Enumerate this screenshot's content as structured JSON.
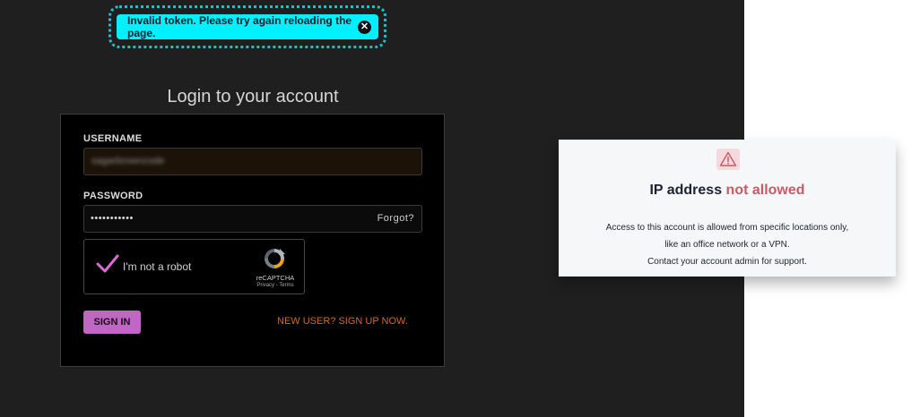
{
  "toast": {
    "message": "Invalid token. Please try again reloading the page.",
    "close_icon": "close-circle-icon",
    "close_glyph": "✕",
    "color": "#00f0ff"
  },
  "login": {
    "title": "Login to your account",
    "username_label": "USERNAME",
    "username_value": "sagarbrowncode",
    "password_label": "PASSWORD",
    "password_value": "•••••••••••",
    "forgot_label": "Forgot?",
    "recaptcha": {
      "label": "I'm not a robot",
      "brand": "reCAPTCHA",
      "terms": "Privacy - Terms",
      "checked": true
    },
    "signin_label": "SIGN IN",
    "signup_label": "NEW USER? SIGN UP NOW.",
    "colors": {
      "accent_button": "#c067c4",
      "signup_link": "#cf6b2f"
    }
  },
  "ip_error": {
    "icon": "warning-triangle-icon",
    "title_main": "IP address ",
    "title_accent": "not allowed",
    "lines": [
      "Access to this account is allowed from specific locations only,",
      "like an office network or a VPN.",
      "Contact your account admin for support."
    ],
    "accent_color": "#c85a66"
  }
}
